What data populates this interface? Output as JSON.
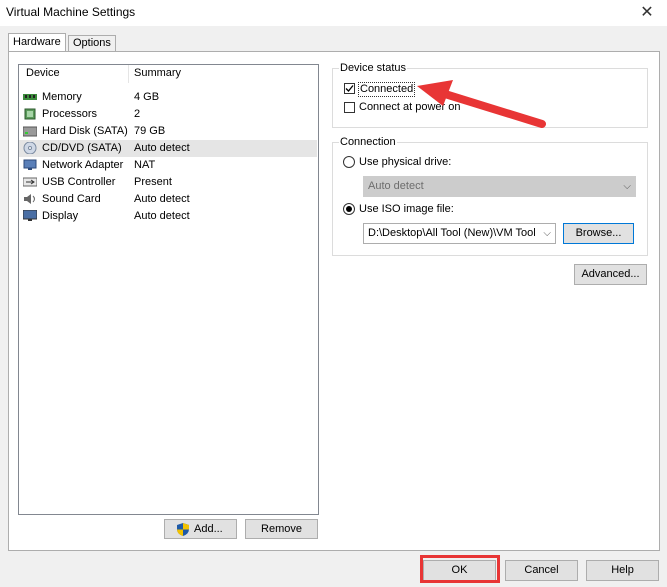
{
  "window": {
    "title": "Virtual Machine Settings",
    "close_glyph": "✕"
  },
  "tabs": [
    {
      "label": "Hardware"
    },
    {
      "label": "Options"
    }
  ],
  "device_list": {
    "headers": {
      "device": "Device",
      "summary": "Summary"
    },
    "rows": [
      {
        "device": "Memory",
        "summary": "4 GB",
        "icon": "memory-icon"
      },
      {
        "device": "Processors",
        "summary": "2",
        "icon": "processor-icon"
      },
      {
        "device": "Hard Disk (SATA)",
        "summary": "79 GB",
        "icon": "hard-disk-icon"
      },
      {
        "device": "CD/DVD (SATA)",
        "summary": "Auto detect",
        "icon": "cd-dvd-icon"
      },
      {
        "device": "Network Adapter",
        "summary": "NAT",
        "icon": "network-adapter-icon"
      },
      {
        "device": "USB Controller",
        "summary": "Present",
        "icon": "usb-icon"
      },
      {
        "device": "Sound Card",
        "summary": "Auto detect",
        "icon": "sound-card-icon"
      },
      {
        "device": "Display",
        "summary": "Auto detect",
        "icon": "display-icon"
      }
    ],
    "selected_index": 3
  },
  "list_buttons": {
    "add": "Add...",
    "remove": "Remove"
  },
  "device_status": {
    "label": "Device status",
    "connected": "Connected",
    "connected_checked": true,
    "connect_power_on": "Connect at power on",
    "connect_power_on_checked": false
  },
  "connection": {
    "label": "Connection",
    "physical_drive_label": "Use physical drive:",
    "physical_drive_value": "Auto detect",
    "iso_label": "Use ISO image file:",
    "iso_value": "D:\\Desktop\\All Tool (New)\\VM Tool",
    "browse": "Browse...",
    "selected": "iso"
  },
  "advanced": "Advanced...",
  "footer": {
    "ok": "OK",
    "cancel": "Cancel",
    "help": "Help"
  },
  "colors": {
    "annotation": "#e83535",
    "focus": "#0078d7"
  }
}
